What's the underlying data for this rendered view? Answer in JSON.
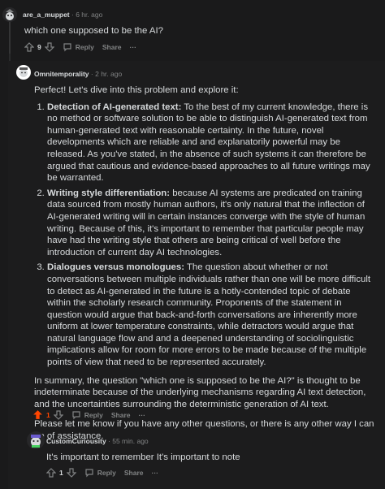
{
  "comment1": {
    "username": "are_a_muppet",
    "time": "· 6 hr. ago",
    "body": "which one supposed to be the AI?",
    "votes": "9",
    "reply": "Reply",
    "share": "Share",
    "more": "···"
  },
  "comment2": {
    "username": "Omnitemporality",
    "time": "· 2 hr. ago",
    "intro": "Perfect! Let's dive into this problem and explore it:",
    "items": [
      {
        "title": "Detection of AI-generated text:",
        "text": " To the best of my current knowledge, there is no method or software solution to be able to distinguish AI-generated text from human-generated text with reasonable certainty. In the future, novel developments which are reliable and and explanatorily powerful may be released. As you've stated, in the absence of such systems it can therefore be argued that cautious and evidence-based approaches to all future writings may be warranted."
      },
      {
        "title": "Writing style differentiation:",
        "text": " because AI systems are predicated on training data sourced from mostly human authors, it's only natural that the inflection of AI-generated writing will in certain instances converge with the style of human writing. Because of this, it's important to remember that particular people may have had the writing style that others are being critical of well before the introduction of current day AI technologies."
      },
      {
        "title": "Dialogues versus monologues:",
        "text": " The question about whether or not conversations between multiple individuals rather than one will be more difficult to detect as AI-generated in the future is a hotly-contended topic of debate within the scholarly research community. Proponents of the statement in question would argue that back-and-forth conversations are inherently more uniform at lower temperature constraints, while detractors would argue that natural language flow and and a deepened understanding of sociolinguistic implications allow for room for more errors to be made because of the multiple points of view that need to be represented accurately."
      }
    ],
    "summary": "In summary, the question \"which one is supposed to be the AI?\" is thought to be indeterminate because of the underlying mechanisms regarding AI text detection, and the uncertainties surrounding the deterministic generation of AI text.",
    "closing": "Please let me know if you have any other questions, or there is any other way I can be of assistance.",
    "votes": "1",
    "reply": "Reply",
    "share": "Share",
    "more": "···"
  },
  "comment3": {
    "username": "CustomCuriousity",
    "time": "· 55 min. ago",
    "body": "It's important to remember It's important to note",
    "votes": "1",
    "reply": "Reply",
    "share": "Share",
    "more": "···"
  },
  "colors": {
    "upvote_active": "#ff4500",
    "background": "#1a1a1b",
    "text": "#d7dadc",
    "muted": "#818384"
  }
}
